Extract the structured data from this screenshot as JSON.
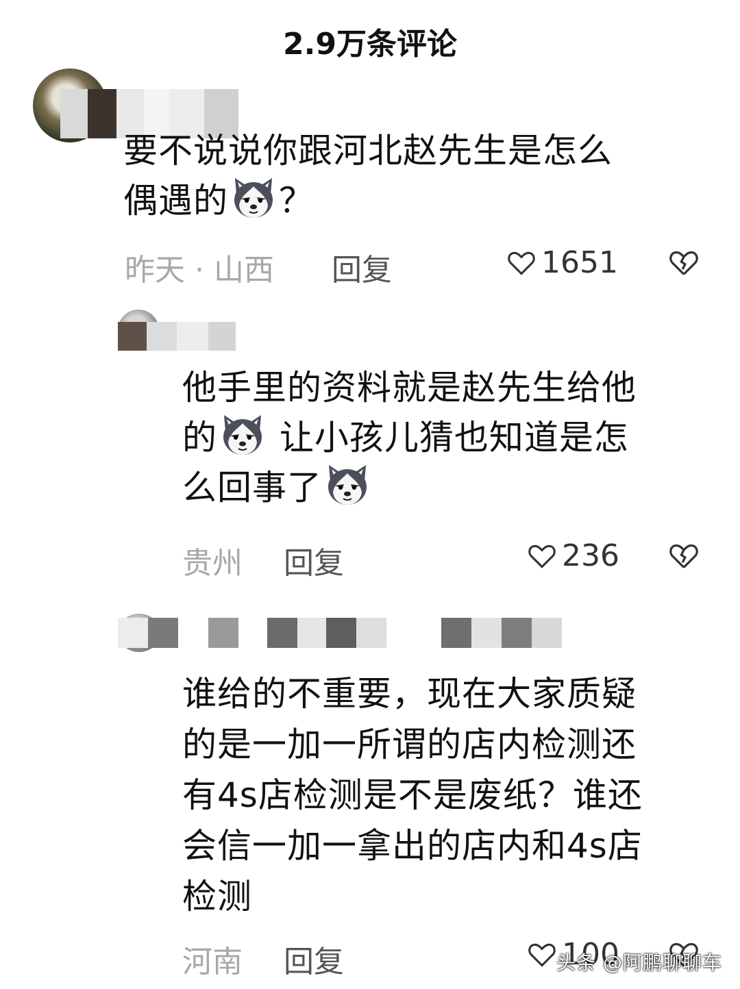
{
  "header": {
    "title": "2.9万条评论"
  },
  "comments": [
    {
      "text_line1": "要不说说你跟河北赵先生是怎么",
      "text_line2_a": "偶遇的",
      "text_line2_b": "？",
      "meta": "昨天 · 山西",
      "reply_label": "回复",
      "likes": "1651",
      "emoji": "husky-emoji"
    },
    {
      "text_line1": "他手里的资料就是赵先生给他",
      "text_line2_a": "的",
      "text_line2_b": " 让小孩儿猜也知道是怎",
      "text_line3_a": "么回事了",
      "meta": "贵州",
      "reply_label": "回复",
      "likes": "236",
      "emoji": "husky-emoji"
    },
    {
      "text_lines": [
        "谁给的不重要，现在大家质疑",
        "的是一加一所谓的店内检测还",
        "有4s店检测是不是废纸？谁还",
        "会信一加一拿出的店内和4s店",
        "检测"
      ],
      "meta": "河南",
      "reply_label": "回复",
      "likes": "100"
    }
  ],
  "watermark": "头条 @阿鹏聊聊车",
  "icons": {
    "like": "heart-outline-icon",
    "dislike": "broken-heart-icon"
  },
  "colors": {
    "text": "#111111",
    "meta": "#a8a8a8",
    "reply": "#555555"
  }
}
